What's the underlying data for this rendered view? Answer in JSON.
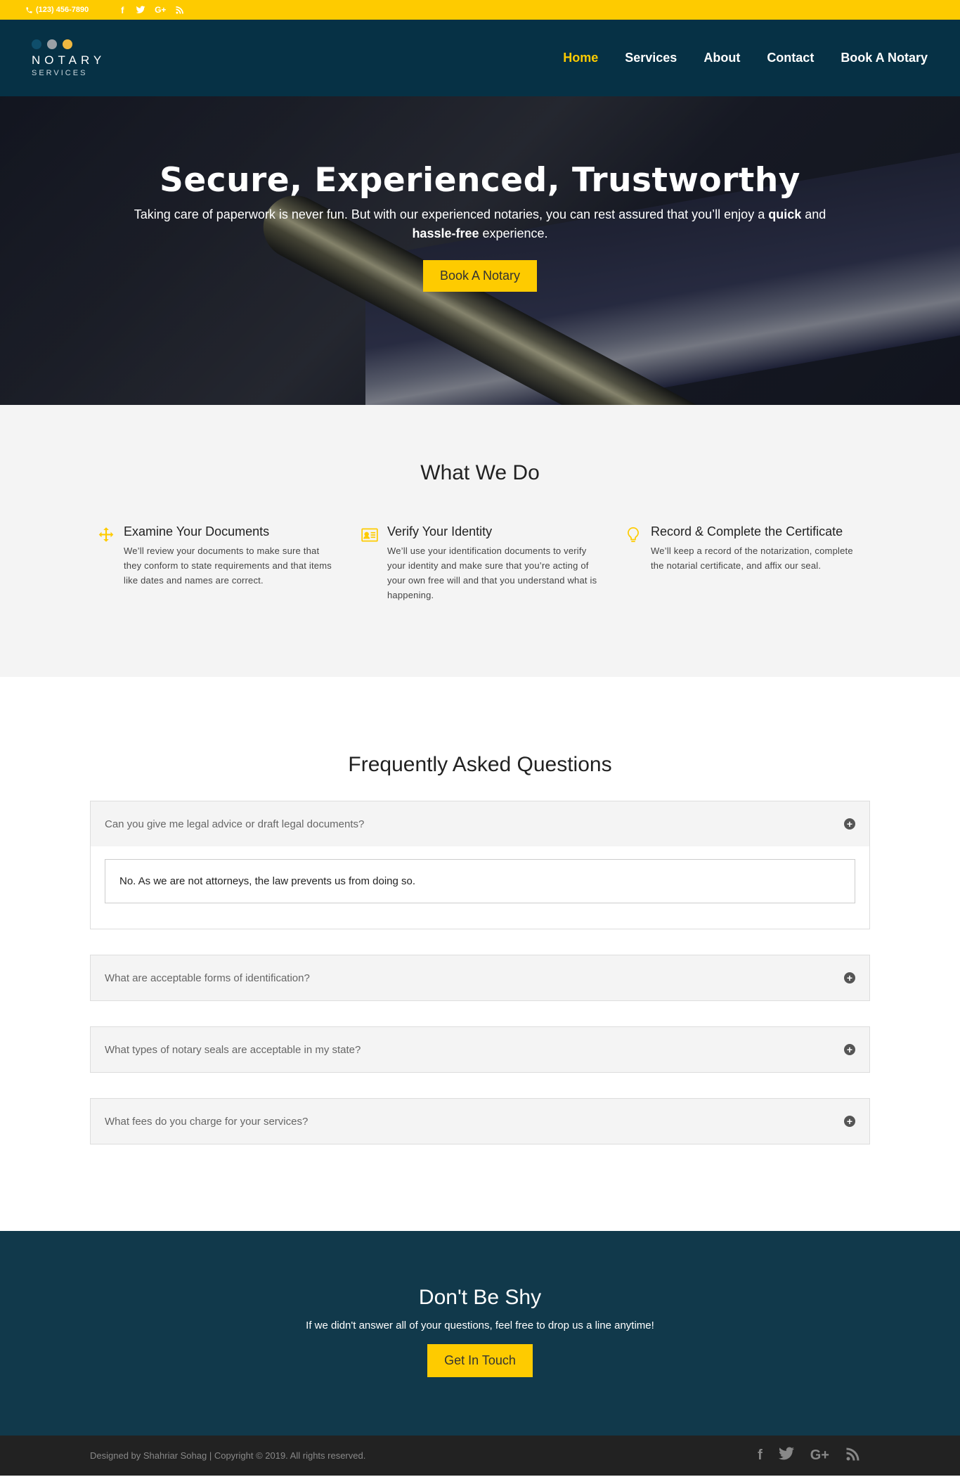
{
  "topbar": {
    "phone": "(123) 456-7890",
    "social_icons": [
      "facebook-icon",
      "twitter-icon",
      "google-plus-icon",
      "rss-icon"
    ]
  },
  "header": {
    "logo_title": "NOTARY",
    "logo_sub": "SERVICES",
    "logo_dot_colors": [
      "#0f4e6b",
      "#9aa0a6",
      "#f0b840"
    ],
    "nav": [
      {
        "label": "Home",
        "active": true
      },
      {
        "label": "Services",
        "active": false
      },
      {
        "label": "About",
        "active": false
      },
      {
        "label": "Contact",
        "active": false
      },
      {
        "label": "Book A Notary",
        "active": false
      }
    ]
  },
  "hero": {
    "title": "Secure, Experienced, Trustworthy",
    "text_1": "Taking care of paperwork is never fun. But with our experienced notaries, you can rest assured that you’ll enjoy a ",
    "bold_1": "quick",
    "text_2": " and ",
    "bold_2": "hassle-free",
    "text_3": " experience.",
    "button": "Book A Notary"
  },
  "whatwedo": {
    "title": "What We Do",
    "features": [
      {
        "icon": "move-arrows-icon",
        "title": "Examine Your Documents",
        "text": "We’ll review your documents to make sure that they conform to state requirements and that items like dates and names are correct."
      },
      {
        "icon": "id-card-icon",
        "title": "Verify Your Identity",
        "text": "We’ll use your identification documents to verify your identity and make sure that you’re acting of your own free will and that you understand what is happening."
      },
      {
        "icon": "lightbulb-icon",
        "title": "Record & Complete the Certificate",
        "text": "We’ll keep a record of the notarization, complete the notarial certificate, and affix our seal."
      }
    ]
  },
  "faq": {
    "title": "Frequently Asked Questions",
    "items": [
      {
        "question": "Can you give me legal advice or draft legal documents?",
        "answer": "No. As we are not attorneys, the law prevents us from doing so.",
        "expanded": true
      },
      {
        "question": "What are acceptable forms of identification?",
        "expanded": false
      },
      {
        "question": "What types of notary seals are acceptable in my state?",
        "expanded": false
      },
      {
        "question": "What fees do you charge for your services?",
        "expanded": false
      }
    ]
  },
  "cta": {
    "title": "Don't Be Shy",
    "text": "If we didn't answer all of your questions, feel free to drop us a line anytime!",
    "button": "Get In Touch"
  },
  "footer": {
    "copyright": "Designed by Shahriar Sohag | Copyright © 2019. All rights reserved.",
    "social_icons": [
      "facebook-icon",
      "twitter-icon",
      "google-plus-icon",
      "rss-icon"
    ]
  },
  "colors": {
    "accent": "#fecb00",
    "header_bg": "#063145",
    "cta_bg": "#11394b",
    "footer_bg": "#222222"
  }
}
